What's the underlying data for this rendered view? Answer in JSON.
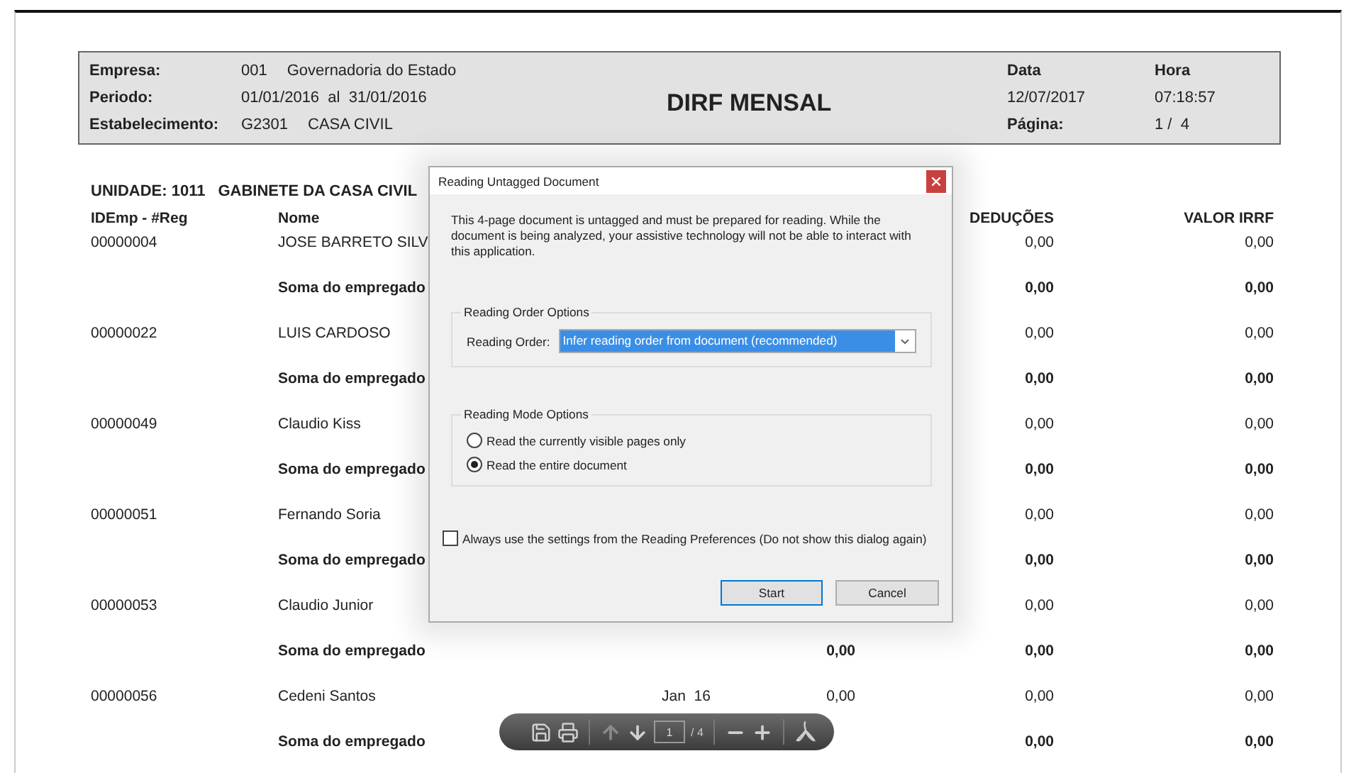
{
  "report_header": {
    "title": "DIRF MENSAL",
    "fields": [
      {
        "label": "Empresa:",
        "code": "001",
        "value": "Governadoria do Estado"
      },
      {
        "label": "Periodo:",
        "code": "01/01/2016  al  31/01/2016"
      },
      {
        "label": "Estabelecimento:",
        "code": "G2301",
        "value": "CASA CIVIL"
      }
    ],
    "right_cells": [
      [
        {
          "kind": "label",
          "text": "Data"
        },
        {
          "kind": "label",
          "text": "Hora"
        }
      ],
      [
        {
          "kind": "value",
          "text": "12/07/2017"
        },
        {
          "kind": "value",
          "text": "07:18:57"
        }
      ],
      [
        {
          "kind": "label",
          "text": "Página:"
        },
        {
          "kind": "value",
          "text": "1 /  4"
        }
      ]
    ]
  },
  "unit": {
    "label": "UNIDADE: 1011",
    "name": "GABINETE DA CASA CIVIL"
  },
  "columns": {
    "id": "IDEmp - #Reg",
    "name": "Nome",
    "deducoes": "DEDUÇÕES",
    "valor_irrf": "VALOR IRRF"
  },
  "rows": [
    {
      "kind": "employee",
      "id": "00000004",
      "name": "JOSE BARRETO SILV",
      "deducoes": "0,00",
      "valor_irrf": "0,00"
    },
    {
      "kind": "subtotal",
      "label": "Soma do empregado",
      "deducoes": "0,00",
      "valor_irrf": "0,00"
    },
    {
      "kind": "employee",
      "id": "00000022",
      "name": "LUIS CARDOSO",
      "deducoes": "0,00",
      "valor_irrf": "0,00"
    },
    {
      "kind": "subtotal",
      "label": "Soma do empregado",
      "deducoes": "0,00",
      "valor_irrf": "0,00"
    },
    {
      "kind": "employee",
      "id": "00000049",
      "name": "Claudio Kiss",
      "deducoes": "0,00",
      "valor_irrf": "0,00"
    },
    {
      "kind": "subtotal",
      "label": "Soma do empregado",
      "deducoes": "0,00",
      "valor_irrf": "0,00"
    },
    {
      "kind": "employee",
      "id": "00000051",
      "name": "Fernando Soria",
      "deducoes": "0,00",
      "valor_irrf": "0,00"
    },
    {
      "kind": "subtotal",
      "label": "Soma do empregado",
      "deducoes": "0,00",
      "valor_irrf": "0,00"
    },
    {
      "kind": "employee",
      "id": "00000053",
      "name": "Claudio Junior",
      "deducoes": "0,00",
      "valor_irrf": "0,00"
    },
    {
      "kind": "subtotal",
      "label": "Soma do empregado",
      "column_4": "0,00",
      "deducoes": "0,00",
      "valor_irrf": "0,00"
    },
    {
      "kind": "employee",
      "id": "00000056",
      "name": "Cedeni Santos",
      "column_3": "Jan  16",
      "column_4": "0,00",
      "deducoes": "0,00",
      "valor_irrf": "0,00"
    },
    {
      "kind": "subtotal",
      "label": "Soma do empregado",
      "deducoes": "0,00",
      "valor_irrf": "0,00"
    }
  ],
  "dialog": {
    "title": "Reading Untagged Document",
    "message": "This 4-page document is untagged and must be prepared for reading. While the document is being analyzed, your assistive technology will not be able to interact with this application.",
    "reading_order": {
      "group": "Reading Order Options",
      "label": "Reading Order:",
      "value": "Infer reading order from document (recommended)"
    },
    "reading_mode": {
      "group": "Reading Mode Options",
      "options": [
        {
          "label": "Read the currently visible pages only",
          "selected": false
        },
        {
          "label": "Read the entire document",
          "selected": true
        }
      ]
    },
    "always_use": {
      "label": "Always use the settings from the Reading Preferences (Do not show this dialog again)",
      "checked": false
    },
    "buttons": [
      {
        "label": "Start",
        "default": true
      },
      {
        "label": "Cancel",
        "default": false
      }
    ]
  },
  "toolbar": {
    "page_value": "1",
    "page_total": "/ 4",
    "previous_disabled": true
  }
}
